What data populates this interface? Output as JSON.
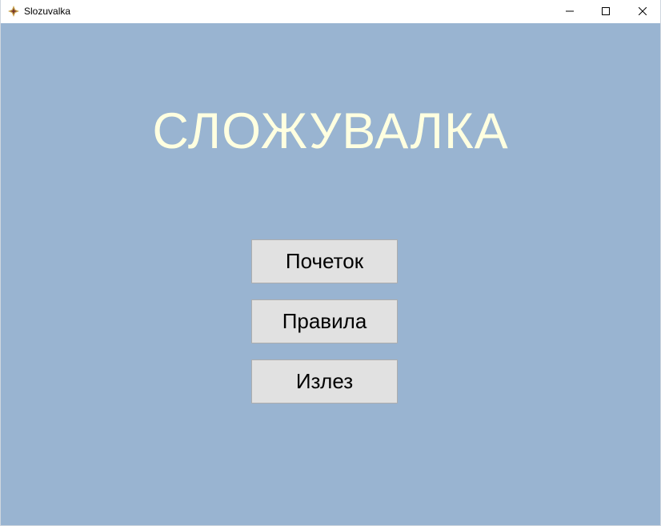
{
  "window": {
    "title": "Slozuvalka",
    "app_icon": "app-logo-icon",
    "controls": {
      "minimize_icon": "minimize-icon",
      "maximize_icon": "maximize-icon",
      "close_icon": "close-icon"
    }
  },
  "main": {
    "heading": "СЛОЖУВАЛКА",
    "buttons": [
      {
        "label": "Почеток"
      },
      {
        "label": "Правила"
      },
      {
        "label": "Излез"
      }
    ]
  },
  "colors": {
    "background": "#99b4d1",
    "heading": "#ffffe0",
    "button_face": "#e1e1e1",
    "button_border": "#adadad"
  }
}
